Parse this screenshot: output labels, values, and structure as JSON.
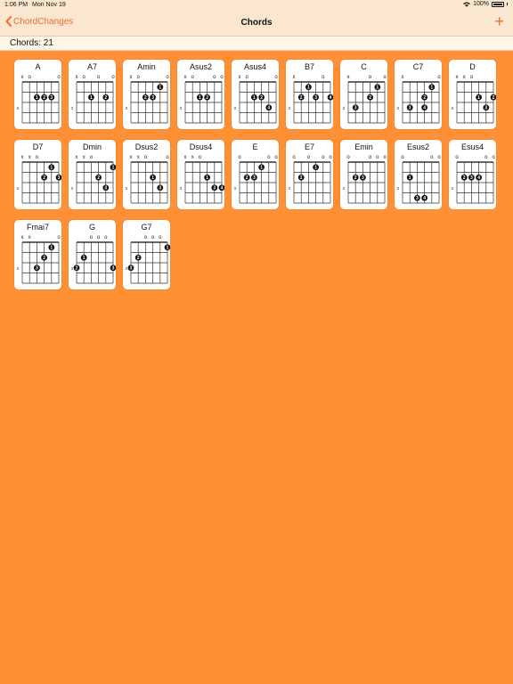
{
  "status": {
    "time": "1:06 PM",
    "date": "Mon Nov 19",
    "battery": "100%"
  },
  "nav": {
    "back_label": "ChordChanges",
    "title": "Chords",
    "add_label": "+"
  },
  "count_label": "Chords: 21",
  "colors": {
    "background": "#ff9036",
    "accent": "#f06a2a",
    "bar": "#fbe6cf"
  },
  "chords": [
    {
      "name": "A",
      "open": [
        "x",
        "o",
        "",
        "",
        "",
        "o"
      ],
      "fingers": [
        [
          3,
          2,
          1
        ],
        [
          4,
          2,
          2
        ],
        [
          5,
          2,
          3
        ]
      ]
    },
    {
      "name": "A7",
      "open": [
        "x",
        "o",
        "",
        "o",
        "",
        "o"
      ],
      "fingers": [
        [
          3,
          2,
          1
        ],
        [
          5,
          2,
          2
        ]
      ]
    },
    {
      "name": "Amin",
      "open": [
        "x",
        "o",
        "",
        "",
        "",
        "o"
      ],
      "fingers": [
        [
          5,
          1,
          1
        ],
        [
          3,
          2,
          2
        ],
        [
          4,
          2,
          3
        ]
      ]
    },
    {
      "name": "Asus2",
      "open": [
        "x",
        "o",
        "",
        "",
        "o",
        "o"
      ],
      "fingers": [
        [
          3,
          2,
          1
        ],
        [
          4,
          2,
          2
        ]
      ]
    },
    {
      "name": "Asus4",
      "open": [
        "x",
        "o",
        "",
        "",
        "",
        "o"
      ],
      "fingers": [
        [
          3,
          2,
          1
        ],
        [
          4,
          2,
          2
        ],
        [
          5,
          3,
          4
        ]
      ]
    },
    {
      "name": "B7",
      "open": [
        "x",
        "",
        "",
        "",
        "o",
        ""
      ],
      "fingers": [
        [
          3,
          1,
          1
        ],
        [
          2,
          2,
          2
        ],
        [
          4,
          2,
          3
        ],
        [
          6,
          2,
          4
        ]
      ]
    },
    {
      "name": "C",
      "open": [
        "x",
        "",
        "",
        "o",
        "",
        "o"
      ],
      "fingers": [
        [
          5,
          1,
          1
        ],
        [
          4,
          2,
          2
        ],
        [
          2,
          3,
          3
        ]
      ]
    },
    {
      "name": "C7",
      "open": [
        "x",
        "",
        "",
        "",
        "",
        "o"
      ],
      "fingers": [
        [
          5,
          1,
          1
        ],
        [
          4,
          2,
          2
        ],
        [
          2,
          3,
          3
        ],
        [
          4,
          3,
          4
        ]
      ]
    },
    {
      "name": "D",
      "open": [
        "x",
        "x",
        "o",
        "",
        "",
        ""
      ],
      "fingers": [
        [
          4,
          2,
          1
        ],
        [
          6,
          2,
          2
        ],
        [
          5,
          3,
          3
        ]
      ]
    },
    {
      "name": "D7",
      "open": [
        "x",
        "x",
        "o",
        "",
        "",
        ""
      ],
      "fingers": [
        [
          5,
          1,
          1
        ],
        [
          4,
          2,
          2
        ],
        [
          6,
          2,
          3
        ]
      ]
    },
    {
      "name": "Dmin",
      "open": [
        "x",
        "x",
        "o",
        "",
        "",
        ""
      ],
      "fingers": [
        [
          6,
          1,
          1
        ],
        [
          4,
          2,
          2
        ],
        [
          5,
          3,
          3
        ]
      ]
    },
    {
      "name": "Dsus2",
      "open": [
        "x",
        "x",
        "o",
        "",
        "",
        "o"
      ],
      "fingers": [
        [
          4,
          2,
          1
        ],
        [
          5,
          3,
          3
        ]
      ]
    },
    {
      "name": "Dsus4",
      "open": [
        "x",
        "x",
        "o",
        "",
        "",
        ""
      ],
      "fingers": [
        [
          4,
          2,
          1
        ],
        [
          5,
          3,
          3
        ],
        [
          6,
          3,
          4
        ]
      ]
    },
    {
      "name": "E",
      "open": [
        "o",
        "",
        "",
        "",
        "o",
        "o"
      ],
      "fingers": [
        [
          4,
          1,
          1
        ],
        [
          2,
          2,
          2
        ],
        [
          3,
          2,
          3
        ]
      ]
    },
    {
      "name": "E7",
      "open": [
        "o",
        "",
        "o",
        "",
        "o",
        "o"
      ],
      "fingers": [
        [
          4,
          1,
          1
        ],
        [
          2,
          2,
          2
        ]
      ]
    },
    {
      "name": "Emin",
      "open": [
        "o",
        "",
        "",
        "o",
        "o",
        "o"
      ],
      "fingers": [
        [
          2,
          2,
          2
        ],
        [
          3,
          2,
          3
        ]
      ]
    },
    {
      "name": "Esus2",
      "open": [
        "o",
        "",
        "",
        "",
        "o",
        "o"
      ],
      "fingers": [
        [
          2,
          2,
          1
        ],
        [
          3,
          4,
          3
        ],
        [
          4,
          4,
          4
        ]
      ]
    },
    {
      "name": "Esus4",
      "open": [
        "o",
        "",
        "",
        "",
        "o",
        "o"
      ],
      "fingers": [
        [
          2,
          2,
          2
        ],
        [
          3,
          2,
          3
        ],
        [
          4,
          2,
          4
        ]
      ]
    },
    {
      "name": "Fmai7",
      "open": [
        "x",
        "x",
        "",
        "",
        "",
        "o"
      ],
      "fingers": [
        [
          5,
          1,
          1
        ],
        [
          4,
          2,
          2
        ],
        [
          3,
          3,
          3
        ]
      ]
    },
    {
      "name": "G",
      "open": [
        "",
        "",
        "o",
        "o",
        "o",
        ""
      ],
      "fingers": [
        [
          2,
          2,
          1
        ],
        [
          1,
          3,
          2
        ],
        [
          6,
          3,
          3
        ]
      ]
    },
    {
      "name": "G7",
      "open": [
        "",
        "",
        "o",
        "o",
        "o",
        ""
      ],
      "fingers": [
        [
          6,
          1,
          1
        ],
        [
          2,
          2,
          2
        ],
        [
          1,
          3,
          3
        ]
      ]
    }
  ],
  "fret_marker": "3"
}
